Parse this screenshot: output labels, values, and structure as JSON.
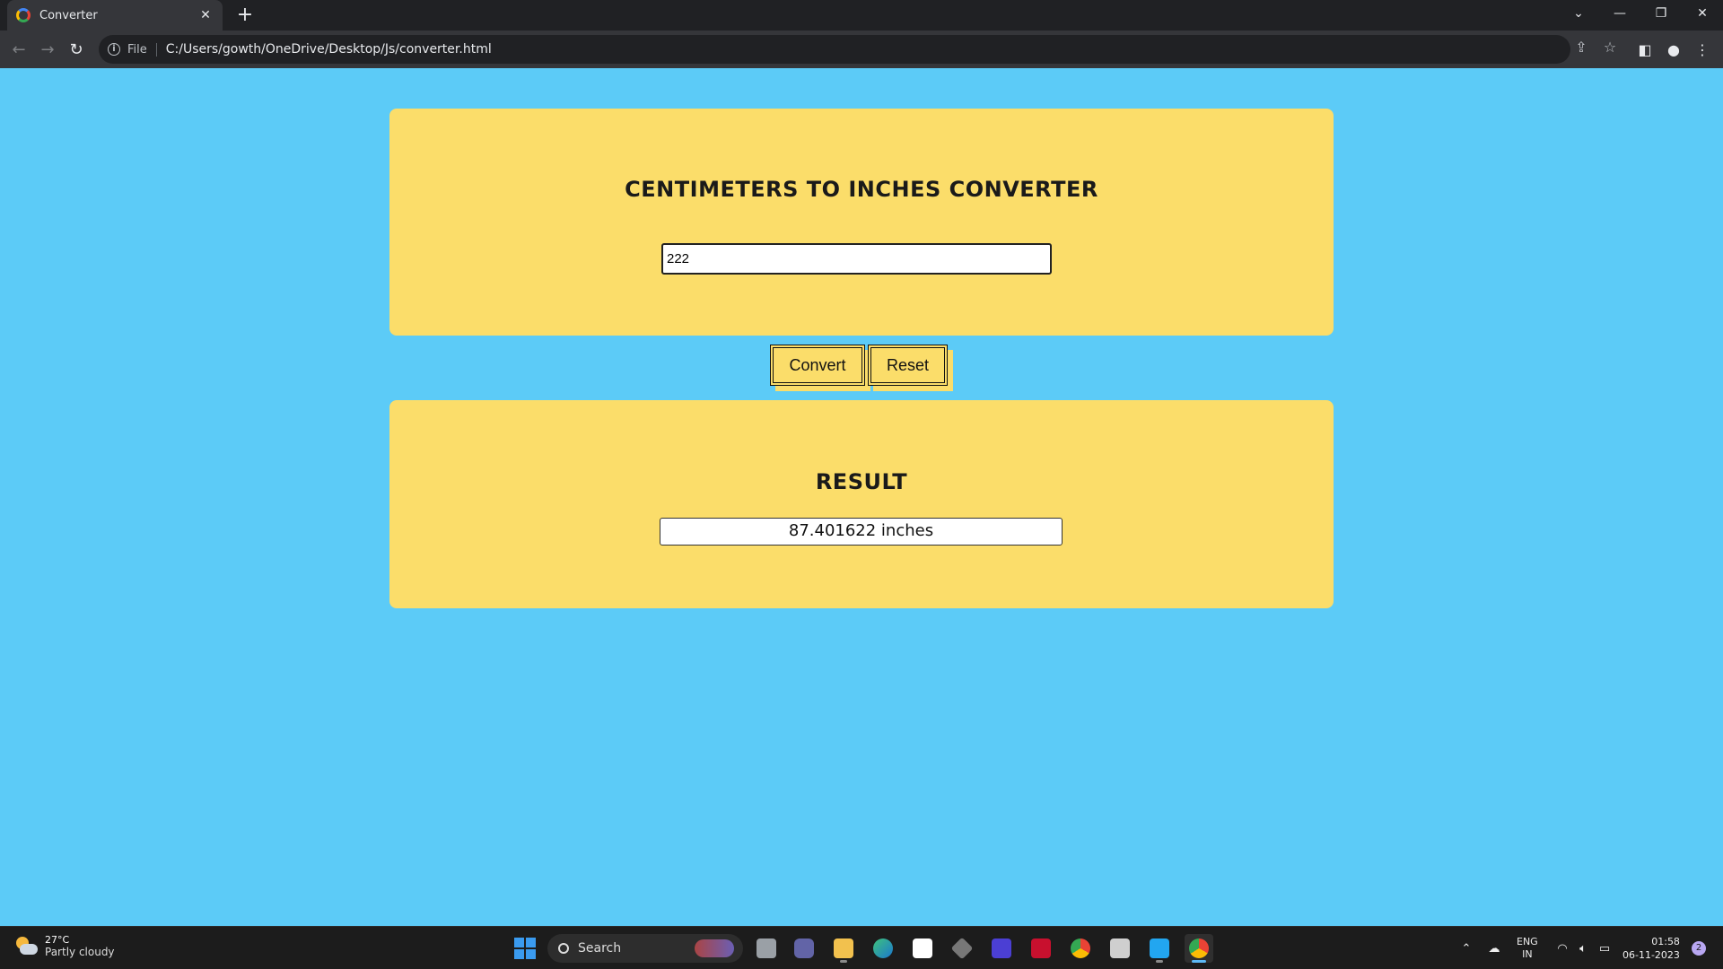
{
  "browser": {
    "tab_title": "Converter",
    "tab_close": "✕",
    "new_tab": "+",
    "scheme_label": "File",
    "url": "C:/Users/gowth/OneDrive/Desktop/Js/converter.html",
    "icons": {
      "back": "back-arrow-icon",
      "forward": "forward-arrow-icon",
      "reload": "reload-icon",
      "info": "info-icon",
      "share": "share-icon",
      "bookmark": "star-icon",
      "sidepanel": "side-panel-icon",
      "profile": "profile-icon",
      "menu": "kebab-menu-icon"
    }
  },
  "page": {
    "background_color": "#5ccbf7",
    "card_color": "#fbdd6a",
    "converter_title": "CENTIMETERS TO INCHES CONVERTER",
    "input_value": "222",
    "convert_label": "Convert",
    "reset_label": "Reset",
    "result_title": "RESULT",
    "result_value": "87.401622 inches"
  },
  "taskbar": {
    "weather_temp": "27°C",
    "weather_condition": "Partly cloudy",
    "search_label": "Search",
    "lang_line1": "ENG",
    "lang_line2": "IN",
    "time": "01:58",
    "date": "06-11-2023",
    "notification_count": "2",
    "apps": [
      "start",
      "search",
      "task-view",
      "teams",
      "file-explorer",
      "edge",
      "store",
      "unity",
      "app-purple",
      "mcafee",
      "chrome",
      "printer",
      "vscode",
      "chrome-active"
    ]
  }
}
